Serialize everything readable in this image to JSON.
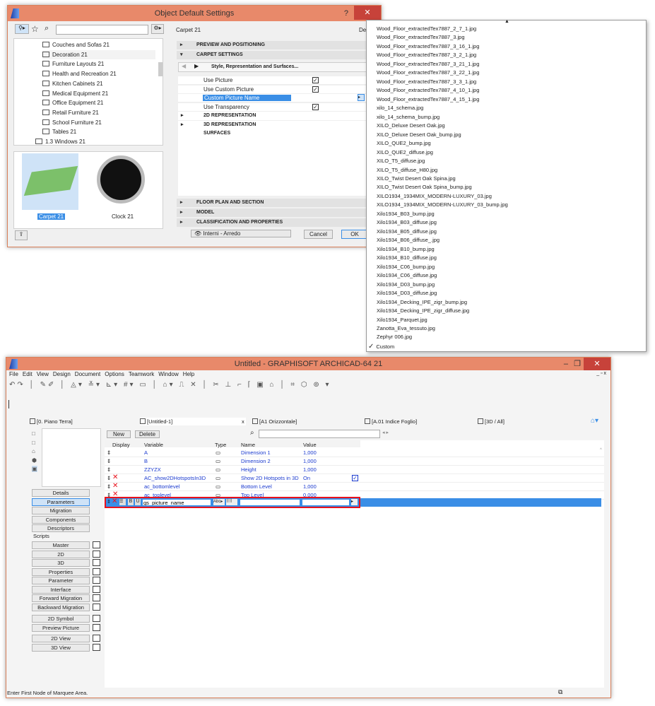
{
  "dialog": {
    "title": "Object Default Settings",
    "help": "?",
    "close": "✕",
    "folders": [
      "Couches and Sofas 21",
      "Decoration 21",
      "Furniture Layouts 21",
      "Health and Recreation 21",
      "Kitchen Cabinets 21",
      "Medical Equipment 21",
      "Office Equipment 21",
      "Retail Furniture 21",
      "School Furniture 21",
      "Tables 21",
      "1.3 Windows 21"
    ],
    "thumbs": [
      "Carpet 21",
      "Clock 21"
    ],
    "object_name": "Carpet 21",
    "default_label": "Def",
    "sections_top": [
      "PREVIEW AND POSITIONING",
      "CARPET SETTINGS"
    ],
    "page_nav": "Style, Representation and Surfaces...",
    "params": [
      {
        "label": "Use Picture",
        "checked": true
      },
      {
        "label": "Use Custom Picture",
        "checked": true
      },
      {
        "label": "Custom Picture Name",
        "checked": null
      },
      {
        "label": "Use Transparency",
        "checked": true
      }
    ],
    "subsections": [
      "2D REPRESENTATION",
      "3D REPRESENTATION",
      "SURFACES"
    ],
    "sections_bottom": [
      "FLOOR PLAN AND SECTION",
      "MODEL",
      "CLASSIFICATION AND PROPERTIES"
    ],
    "layer": "Interni - Arredo",
    "cancel": "Cancel",
    "ok": "OK"
  },
  "dropdown": {
    "items": [
      "Wood_Floor_extractedTex7887_2_7_1.jpg",
      "Wood_Floor_extractedTex7887_3.jpg",
      "Wood_Floor_extractedTex7887_3_16_1.jpg",
      "Wood_Floor_extractedTex7887_3_2_1.jpg",
      "Wood_Floor_extractedTex7887_3_21_1.jpg",
      "Wood_Floor_extractedTex7887_3_22_1.jpg",
      "Wood_Floor_extractedTex7887_3_3_1.jpg",
      "Wood_Floor_extractedTex7887_4_10_1.jpg",
      "Wood_Floor_extractedTex7887_4_15_1.jpg",
      "xilo_14_schema.jpg",
      "xilo_14_schema_bump.jpg",
      "XILO_Deluxe Desert Oak.jpg",
      "XILO_Deluxe Desert Oak_bump.jpg",
      "XILO_QUE2_bump.jpg",
      "XILO_QUE2_diffuse.jpg",
      "XILO_T5_diffuse.jpg",
      "XILO_T5_diffuse_H80.jpg",
      "XILO_Twist Desert Oak Spina.jpg",
      "XILO_Twist Desert Oak Spina_bump.jpg",
      "XILO1934_1934MIX_MODERN-LUXURY_03.jpg",
      "XILO1934_1934MIX_MODERN-LUXURY_03_bump.jpg",
      "Xilo1934_B03_bump.jpg",
      "Xilo1934_B03_diffuse.jpg",
      "Xilo1934_B05_diffuse.jpg",
      "Xilo1934_B06_diffuse_.jpg",
      "Xilo1934_B10_bump.jpg",
      "Xilo1934_B10_diffuse.jpg",
      "Xilo1934_C06_bump.jpg",
      "Xilo1934_C06_diffuse.jpg",
      "Xilo1934_D03_bump.jpg",
      "Xilo1934_D03_diffuse.jpg",
      "Xilo1934_Decking_IPE_zigr_bump.jpg",
      "Xilo1934_Decking_IPE_zigr_diffuse.jpg",
      "Xilo1934_Parquet.jpg",
      "Zanotta_Eva_tessuto.jpg",
      "Zephyr 006.jpg"
    ],
    "custom": "Custom",
    "checkmark": "✓"
  },
  "main": {
    "title": "Untitled - GRAPHISOFT ARCHICAD-64 21",
    "menu": [
      "File",
      "Edit",
      "View",
      "Design",
      "Document",
      "Options",
      "Teamwork",
      "Window",
      "Help"
    ],
    "tabs": [
      "[0. Piano Terra]",
      "[Untitled-1]",
      "[A1 Orizzontale]",
      "[A.01 Indice Foglio]",
      "[3D / All]"
    ],
    "tab_close": "x",
    "new": "New",
    "delete": "Delete",
    "columns": [
      "Display",
      "Variable",
      "Type",
      "Name",
      "Value"
    ],
    "rows": [
      {
        "var": "A",
        "name": "Dimension 1",
        "value": "1,000",
        "x": false
      },
      {
        "var": "B",
        "name": "Dimension 2",
        "value": "1,000",
        "x": false
      },
      {
        "var": "ZZYZX",
        "name": "Height",
        "value": "1,000",
        "x": false
      },
      {
        "var": "AC_show2DHotspotsIn3D",
        "name": "Show 2D Hotspots in 3D",
        "value": "On",
        "x": true,
        "check": true
      },
      {
        "var": "ac_bottomlevel",
        "name": "Bottom Level",
        "value": "1,000",
        "x": true
      },
      {
        "var": "ac_toplevel",
        "name": "Top Level",
        "value": "0,000",
        "x": true
      }
    ],
    "edit_row": {
      "var": "gs_picture_name",
      "type": "Abc",
      "b": "B",
      "u": "U",
      "name": "",
      "value": ""
    },
    "side_buttons": [
      "Details",
      "Parameters",
      "Migration",
      "Components",
      "Descriptors"
    ],
    "scripts_label": "Scripts",
    "scripts": [
      "Master",
      "2D",
      "3D",
      "Properties",
      "Parameter",
      "Interface",
      "Forward Migration",
      "Backward Migration"
    ],
    "scripts2": [
      "2D Symbol",
      "Preview Picture"
    ],
    "scripts3": [
      "2D View",
      "3D View"
    ],
    "status": "Enter First Node of Marquee Area."
  }
}
